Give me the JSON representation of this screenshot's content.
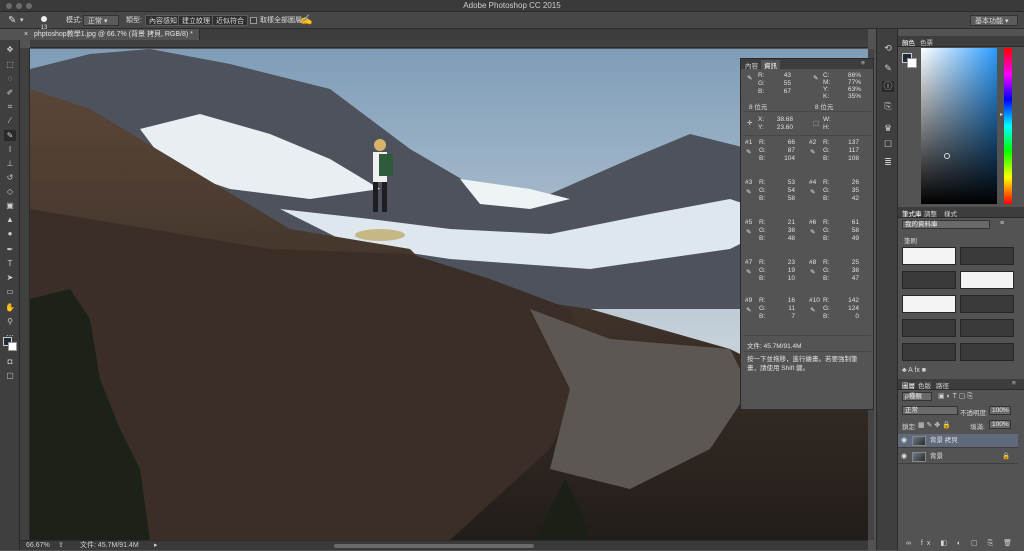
{
  "window": {
    "title": "Adobe Photoshop CC 2015"
  },
  "options_bar": {
    "brush_size": "13",
    "mode_label": "模式:",
    "mode_value": "正常",
    "type_label": "類型:",
    "btn_content_aware": "內容感知",
    "btn_create_texture": "建立紋理",
    "btn_proximity_match": "近似符合",
    "sample_all_layers": "取樣全部圖層",
    "workspace": "基本功能"
  },
  "document": {
    "tab_label": "phptoshop教學1.jpg @ 66.7% (背景 拷貝, RGB/8) *"
  },
  "status": {
    "zoom": "66.67%",
    "file_info": "文件: 45.7M/91.4M"
  },
  "info_panel": {
    "tab_content": "內容",
    "tab_info": "資訊",
    "rgb": {
      "r": "43",
      "g": "55",
      "b": "67"
    },
    "cmyk": {
      "c": "86%",
      "m": "77%",
      "y": "63%",
      "k": "35%"
    },
    "bits_left": "8 位元",
    "bits_right": "8 位元",
    "xy": {
      "x": "38.68",
      "y": "23.60"
    },
    "wh": {
      "w": "",
      "h": ""
    },
    "samplers": [
      {
        "id": "#1",
        "r": "66",
        "g": "87",
        "b": "104"
      },
      {
        "id": "#2",
        "r": "137",
        "g": "117",
        "b": "108"
      },
      {
        "id": "#3",
        "r": "53",
        "g": "54",
        "b": "58"
      },
      {
        "id": "#4",
        "r": "26",
        "g": "35",
        "b": "42"
      },
      {
        "id": "#5",
        "r": "21",
        "g": "38",
        "b": "48"
      },
      {
        "id": "#6",
        "r": "61",
        "g": "58",
        "b": "49"
      },
      {
        "id": "#7",
        "r": "23",
        "g": "19",
        "b": "10"
      },
      {
        "id": "#8",
        "r": "25",
        "g": "38",
        "b": "47"
      },
      {
        "id": "#9",
        "r": "16",
        "g": "11",
        "b": "7"
      },
      {
        "id": "#10",
        "r": "142",
        "g": "124",
        "b": "0"
      }
    ],
    "file_size": "文件: 45.7M/91.4M",
    "hint": "按一下並拖移，進行繪畫。若要強制筆畫，請使用 Shift 鍵。"
  },
  "color_panel": {
    "tab_color": "顏色",
    "tab_swatches": "色票"
  },
  "brush_panel": {
    "tab_presets": "筆式庫",
    "tab_adjust": "調整",
    "tab_style": "樣式",
    "library": "我的資料庫",
    "section": "筆刷"
  },
  "layers_panel": {
    "tab_layers": "圖層",
    "tab_channels": "色版",
    "tab_paths": "路徑",
    "kind": "ρ種類",
    "blend_mode": "正常",
    "opacity_label": "不透明度:",
    "opacity": "100%",
    "lock_label": "鎖定:",
    "fill_label": "填滿:",
    "fill": "100%",
    "layers": [
      {
        "name": "背景 拷貝",
        "selected": true
      },
      {
        "name": "背景",
        "selected": false
      }
    ]
  }
}
